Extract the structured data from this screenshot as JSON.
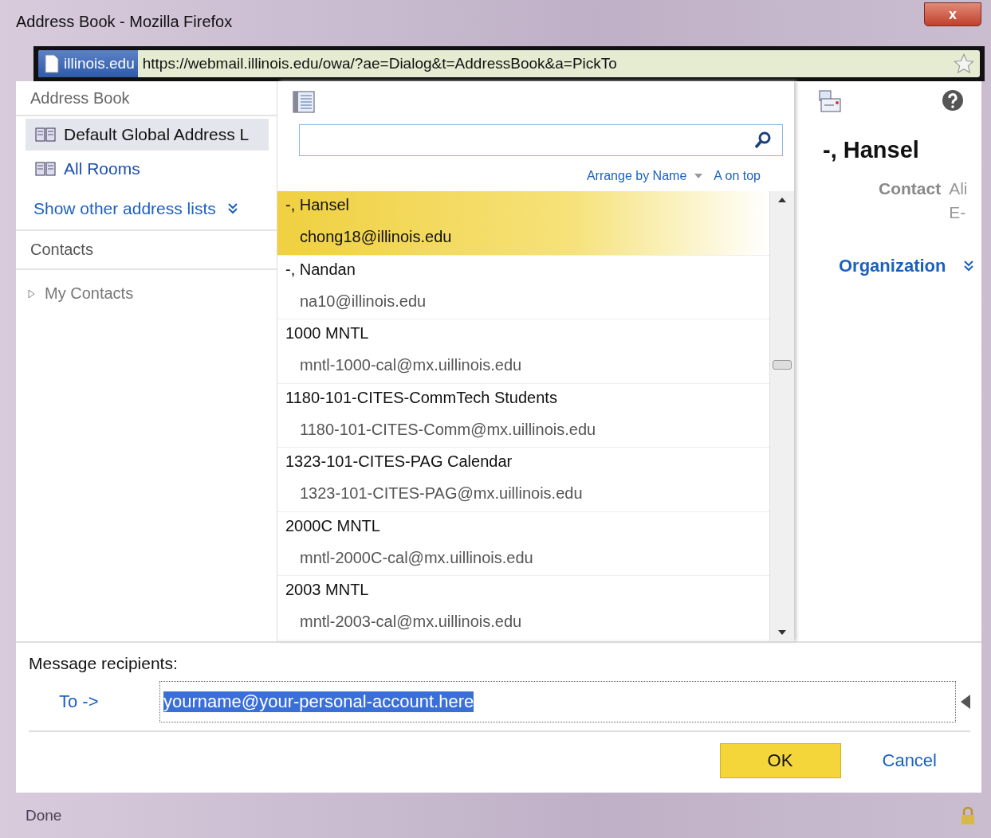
{
  "window": {
    "title": "Address Book - Mozilla Firefox",
    "close": "x"
  },
  "address_bar": {
    "site": "illinois.edu",
    "url": "https://webmail.illinois.edu/owa/?ae=Dialog&t=AddressBook&a=PickTo"
  },
  "sidebar": {
    "header": "Address Book",
    "lists": [
      {
        "label": "Default Global Address L",
        "selected": true
      },
      {
        "label": "All Rooms",
        "selected": false
      }
    ],
    "show_other": "Show other address lists",
    "contacts_header": "Contacts",
    "tree": [
      {
        "label": "My Contacts",
        "expanded": false
      }
    ]
  },
  "list": {
    "arrange": "Arrange by Name",
    "order": "A on top",
    "contacts": [
      {
        "name": "-, Hansel",
        "email": "chong18@illinois.edu",
        "selected": true
      },
      {
        "name": "-, Nandan",
        "email": "na10@illinois.edu",
        "selected": false
      },
      {
        "name": "1000 MNTL",
        "email": "mntl-1000-cal@mx.uillinois.edu",
        "selected": false
      },
      {
        "name": "1180-101-CITES-CommTech Students",
        "email": "1180-101-CITES-Comm@mx.uillinois.edu",
        "selected": false
      },
      {
        "name": "1323-101-CITES-PAG Calendar",
        "email": "1323-101-CITES-PAG@mx.uillinois.edu",
        "selected": false
      },
      {
        "name": "2000C MNTL",
        "email": "mntl-2000C-cal@mx.uillinois.edu",
        "selected": false
      },
      {
        "name": "2003 MNTL",
        "email": "mntl-2003-cal@mx.uillinois.edu",
        "selected": false
      }
    ]
  },
  "details": {
    "name": "-, Hansel",
    "section": "Contact",
    "values": [
      "Ali",
      "E-"
    ],
    "organization": "Organization"
  },
  "recipients": {
    "label": "Message recipients:",
    "to": "To ->",
    "value": "yourname@your-personal-account.here"
  },
  "buttons": [
    {
      "label": "OK",
      "kind": "primary"
    },
    {
      "label": "Cancel",
      "kind": "link"
    }
  ],
  "status_bar": "Done"
}
